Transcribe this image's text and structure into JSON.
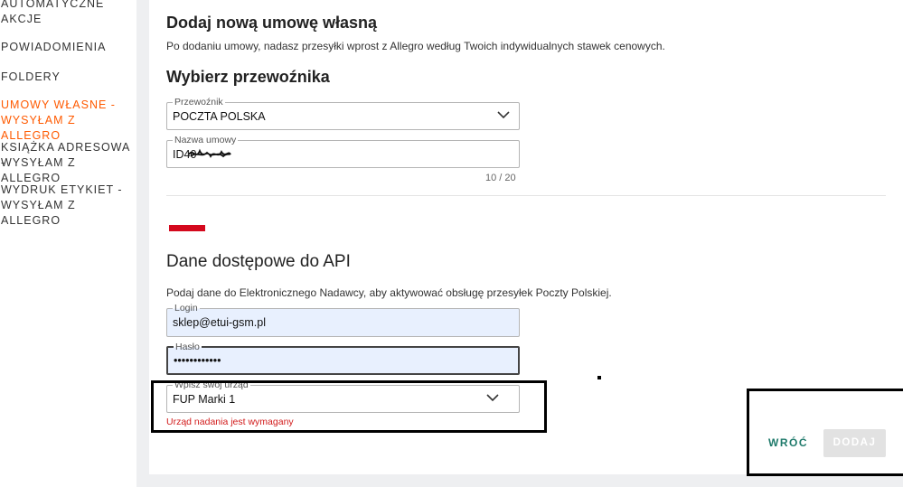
{
  "sidebar": {
    "items": [
      {
        "label": "AUTOMATYCZNE",
        "active": false
      },
      {
        "label": "AKCJE",
        "active": false
      },
      {
        "label": "POWIADOMIENIA",
        "active": false
      },
      {
        "label": "FOLDERY",
        "active": false
      },
      {
        "label": "UMOWY WŁASNE -",
        "active": true
      },
      {
        "label": "WYSYŁAM Z ALLEGRO",
        "active": true
      },
      {
        "label": "KSIĄŻKA ADRESOWA -",
        "active": false
      },
      {
        "label": "WYSYŁAM Z ALLEGRO",
        "active": false
      },
      {
        "label": "WYDRUK ETYKIET -",
        "active": false
      },
      {
        "label": "WYSYŁAM Z ALLEGRO",
        "active": false
      }
    ]
  },
  "section_add": {
    "title": "Dodaj nową umowę własną",
    "description": "Po dodaniu umowy, nadasz przesyłki wprost z Allegro według Twoich indywidualnych stawek cenowych."
  },
  "carrier_section": {
    "title": "Wybierz przewoźnika",
    "carrier_field": {
      "label": "Przewoźnik",
      "value": "POCZTA POLSKA"
    },
    "contract_field": {
      "label": "Nazwa umowy",
      "value": "ID40"
    },
    "counter": "10 / 20"
  },
  "api_section": {
    "title": "Dane dostępowe do API",
    "description": "Podaj dane do Elektronicznego Nadawcy, aby aktywować obsługę przesyłek Poczty Polskiej.",
    "login_field": {
      "label": "Login",
      "value": "sklep@etui-gsm.pl"
    },
    "password_field": {
      "label": "Hasło",
      "value": "••••••••••••"
    },
    "office_field": {
      "label": "Wpisz swój urząd",
      "value": "FUP Marki 1"
    },
    "office_error": "Urząd nadania jest wymagany"
  },
  "actions": {
    "back_label": "WRÓĆ",
    "add_label": "DODAJ"
  },
  "colors": {
    "accent": "#ff5a00",
    "link": "#1f7a6b",
    "error": "#d21b1b",
    "autofill": "#e8f0fe"
  }
}
